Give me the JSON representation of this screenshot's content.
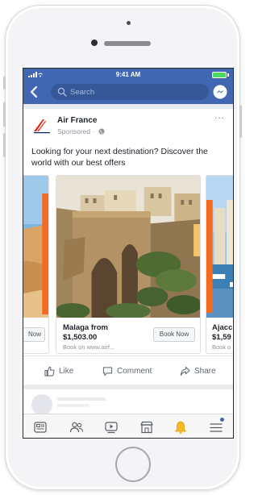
{
  "status_bar": {
    "time": "9:41 AM"
  },
  "header": {
    "search_placeholder": "Search",
    "icons": [
      "back-chevron-icon",
      "search-icon",
      "messenger-icon"
    ]
  },
  "post": {
    "advertiser": "Air France",
    "sponsored": "Sponsored ·",
    "more": "···",
    "text": "Looking for your next destination? Discover the world with our best offers",
    "carousel": [
      {
        "title": "",
        "price": "",
        "link": "",
        "button": "Now"
      },
      {
        "title": "Malaga from",
        "price": "$1,503.00",
        "link": "Book on www.airf...",
        "button": "Book Now"
      },
      {
        "title": "Ajacc",
        "price": "$1,59",
        "link": "Book o",
        "button": ""
      }
    ],
    "actions": {
      "like": "Like",
      "comment": "Comment",
      "share": "Share"
    }
  },
  "tab_bar": {
    "tabs": [
      "news-feed-icon",
      "friends-icon",
      "watch-icon",
      "marketplace-icon",
      "notifications-icon",
      "menu-icon"
    ],
    "active": "notifications-icon"
  },
  "colors": {
    "fb_blue": "#4267b2",
    "search_bg": "#365899",
    "notification_bell": "#f7b928"
  }
}
